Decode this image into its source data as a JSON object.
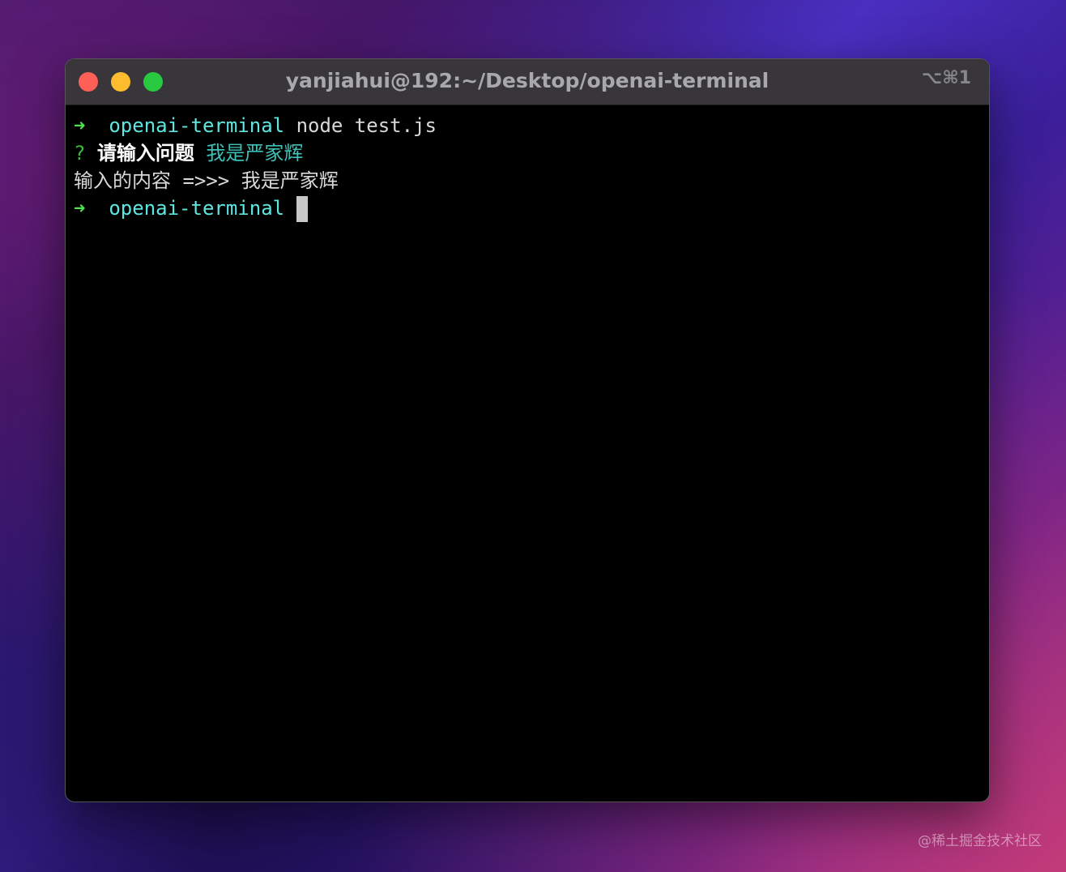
{
  "window": {
    "title": "yanjiahui@192:~/Desktop/openai-terminal",
    "shortcut": "⌥⌘1"
  },
  "terminal": {
    "prompt_arrow": "➜",
    "cwd": "openai-terminal",
    "command": "node test.js",
    "question_mark": "?",
    "question": "请输入问题",
    "answer": "我是严家辉",
    "output": "输入的内容 =>>> 我是严家辉"
  },
  "watermark": "@稀土掘金技术社区",
  "colors": {
    "close": "#fe5f57",
    "minimize": "#febc2e",
    "maximize": "#28c840"
  }
}
